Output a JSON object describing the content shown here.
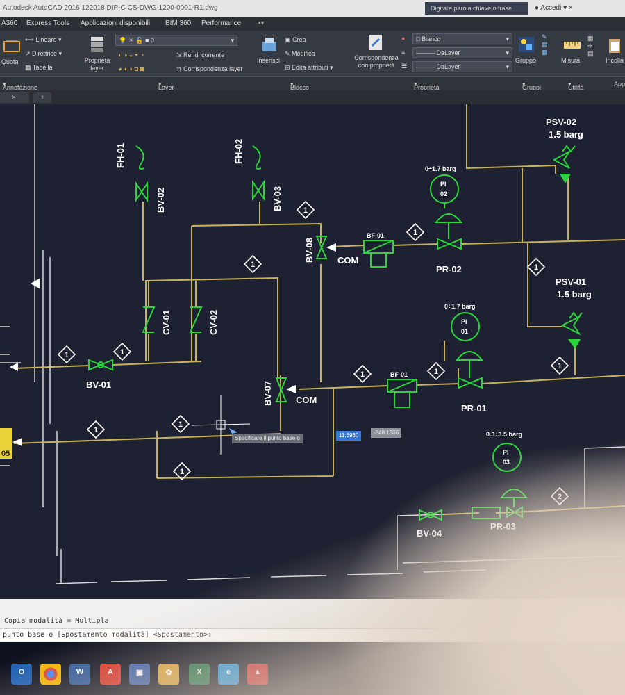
{
  "window": {
    "title": "Autodesk AutoCAD 2016   122018 DIP-C CS-DWG-1200-0001-R1.dwg",
    "search_placeholder": "Digitare parola chiave o frase",
    "account": "Accedi"
  },
  "menu": [
    "A360",
    "Express Tools",
    "Applicazioni disponibili",
    "BIM 360",
    "Performance"
  ],
  "ribbon": {
    "annotazione": {
      "quota": "Quota",
      "lineare": "Lineare",
      "direttrice": "Direttrice",
      "tabella": "Tabella"
    },
    "layer": {
      "proprieta_layer": "Proprietà layer",
      "layer_value": "0",
      "rendi_corrente": "Rendi corrente",
      "corrispondenza_layer": "Corrispondenza layer"
    },
    "blocco": {
      "inserisci": "Inserisci",
      "crea": "Crea",
      "modifica": "Modifica",
      "edita_attributi": "Edita attributi"
    },
    "proprieta": {
      "corrispondenza": "Corrispondenza con proprietà",
      "color": "Bianco",
      "linetype": "DaLayer",
      "lineweight": "DaLayer"
    },
    "gruppi": {
      "gruppo": "Gruppo"
    },
    "utilita": {
      "misura": "Misura"
    },
    "appunti": {
      "incolla": "Incolla"
    }
  },
  "panels": [
    "Annotazione",
    "Layer",
    "Blocco",
    "Proprietà",
    "Gruppi",
    "Utilità",
    "App"
  ],
  "drawing": {
    "tags": {
      "fh01": "FH-01",
      "fh02": "FH-02",
      "bv01": "BV-01",
      "bv02": "BV-02",
      "bv03": "BV-03",
      "bv04": "BV-04",
      "bv07": "BV-07",
      "bv08": "BV-08",
      "cv01": "CV-01",
      "cv02": "CV-02",
      "com1": "COM",
      "com2": "COM",
      "bf01a": "BF-01",
      "bf01b": "BF-01",
      "pr01": "PR-01",
      "pr02": "PR-02",
      "pr03": "PR-03",
      "psv01": "PSV-01",
      "psv01_set": "1.5 barg",
      "psv02": "PSV-02",
      "psv02_set": "1.5 barg",
      "pi01_range": "0÷1.7 barg",
      "pi02_range": "0÷1.7 barg",
      "pi03_range": "0.3÷3.5 barg",
      "pi": "PI",
      "pi01": "01",
      "pi02": "02",
      "pi03": "03",
      "edge_tag": "05"
    },
    "markers": {
      "one": "1",
      "two": "2"
    },
    "cursor_tooltip": {
      "prompt": "Specificare il punto base o",
      "value1": "11.6960",
      "value2": "-348.1306"
    }
  },
  "command_line": {
    "line1": "Copia modalità = Multipla",
    "line2": "punto base o [Spostamento modalità] <Spostamento>:"
  },
  "taskbar": {
    "icons": [
      "outlook-icon",
      "chrome-icon",
      "word-icon",
      "acrobat-icon",
      "save-icon",
      "paint-icon",
      "excel-icon",
      "ie-icon",
      "autocad-icon"
    ]
  },
  "colors": {
    "canvas_bg": "#1e2131",
    "line_yellow": "#c9b35a",
    "symbol_green": "#2bd43a",
    "text_white": "#ffffff"
  }
}
